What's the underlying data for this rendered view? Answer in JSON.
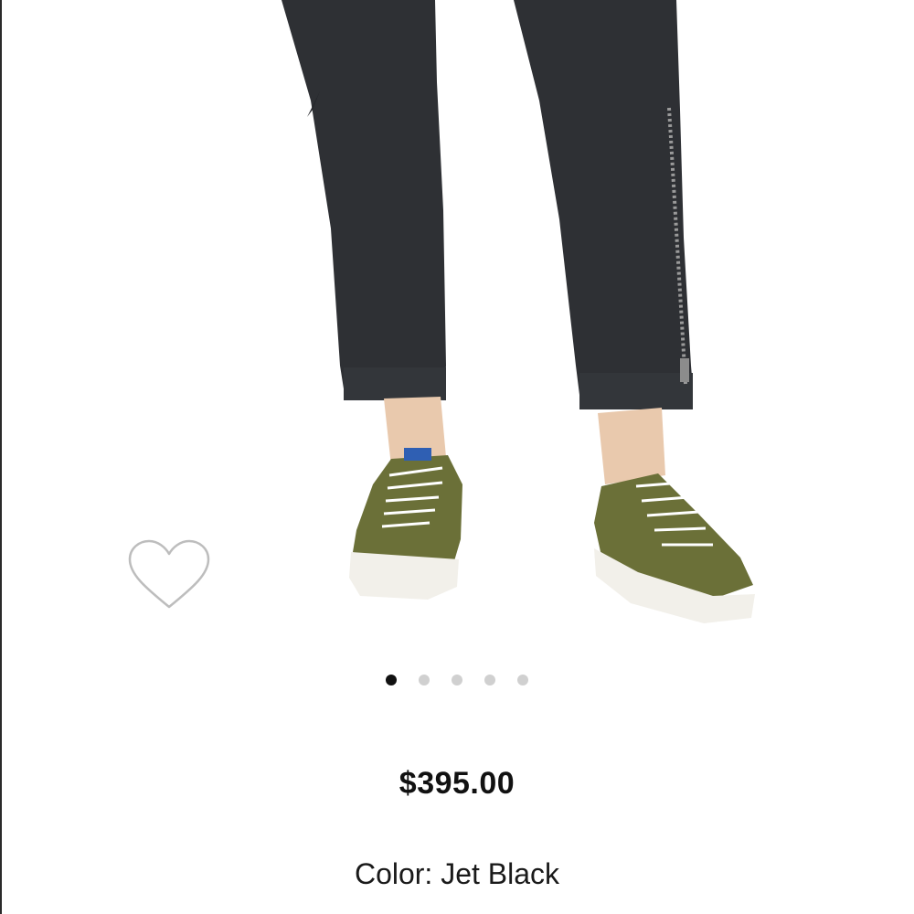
{
  "product": {
    "price": "$395.00",
    "color_label": "Color: Jet Black",
    "image": {
      "pants_color": "#2e3034",
      "sneaker_color": "#6b7038",
      "sole_color": "#f2f0ea",
      "skin_color": "#e9c9ad"
    }
  },
  "carousel": {
    "total": 5,
    "active_index": 0,
    "active_color": "#111111",
    "inactive_color": "#d0d0d0"
  },
  "icons": {
    "favorite": "heart-outline-icon"
  }
}
